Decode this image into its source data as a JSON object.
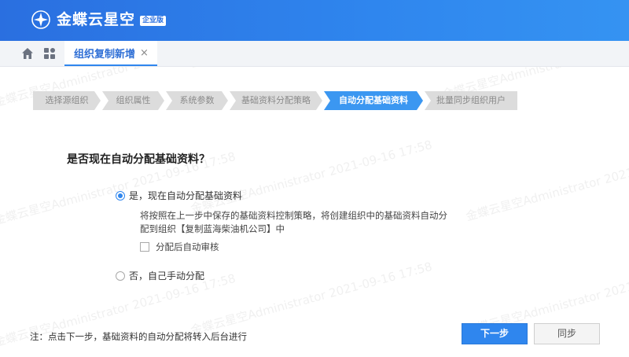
{
  "header": {
    "brand": "金蝶云星空",
    "edition": "企业版"
  },
  "tabbar": {
    "home_icon": "home-icon",
    "apps_icon": "apps-icon",
    "active_tab": "组织复制新增",
    "close_glyph": "×"
  },
  "steps": [
    {
      "label": "选择源组织",
      "active": false
    },
    {
      "label": "组织属性",
      "active": false
    },
    {
      "label": "系统参数",
      "active": false
    },
    {
      "label": "基础资料分配策略",
      "active": false
    },
    {
      "label": "自动分配基础资料",
      "active": true
    },
    {
      "label": "批量同步组织用户",
      "active": false
    }
  ],
  "question": "是否现在自动分配基础资料？",
  "options": {
    "yes_label": "是，现在自动分配基础资料",
    "yes_checked": true,
    "yes_desc": "将按照在上一步中保存的基础资料控制策略，将创建组织中的基础资料自动分配到组织【复制蓝海柴油机公司】中",
    "auto_audit_label": "分配后自动审核",
    "auto_audit_checked": false,
    "no_label": "否，自己手动分配",
    "no_checked": false
  },
  "footer": {
    "note": "注：点击下一步，基础资料的自动分配将转入后台进行",
    "next_label": "下一步",
    "sync_label": "同步"
  },
  "watermark": "金蝶云星空Administrator 2021-09-16 17:58",
  "colors": {
    "brand_blue": "#2f86ee",
    "active_step": "#3b97f1",
    "inactive_step": "#dcdcdc"
  }
}
